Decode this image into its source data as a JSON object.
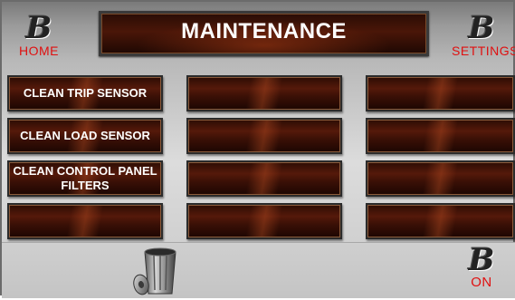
{
  "title": "MAINTENANCE",
  "nav": {
    "home_label": "HOME",
    "settings_label": "SETTINGS",
    "logo_glyph": "B"
  },
  "power": {
    "status_label": "ON"
  },
  "buttons": {
    "col1": [
      "CLEAN TRIP SENSOR",
      "CLEAN LOAD SENSOR",
      "CLEAN CONTROL PANEL FILTERS",
      ""
    ],
    "col2": [
      "",
      "",
      "",
      ""
    ],
    "col3": [
      "",
      "",
      "",
      ""
    ]
  },
  "icons": {
    "trash": "trash-can-icon",
    "logo": "b-logo-icon"
  },
  "colors": {
    "accent_red": "#e01010",
    "button_dark": "#3a1006"
  }
}
